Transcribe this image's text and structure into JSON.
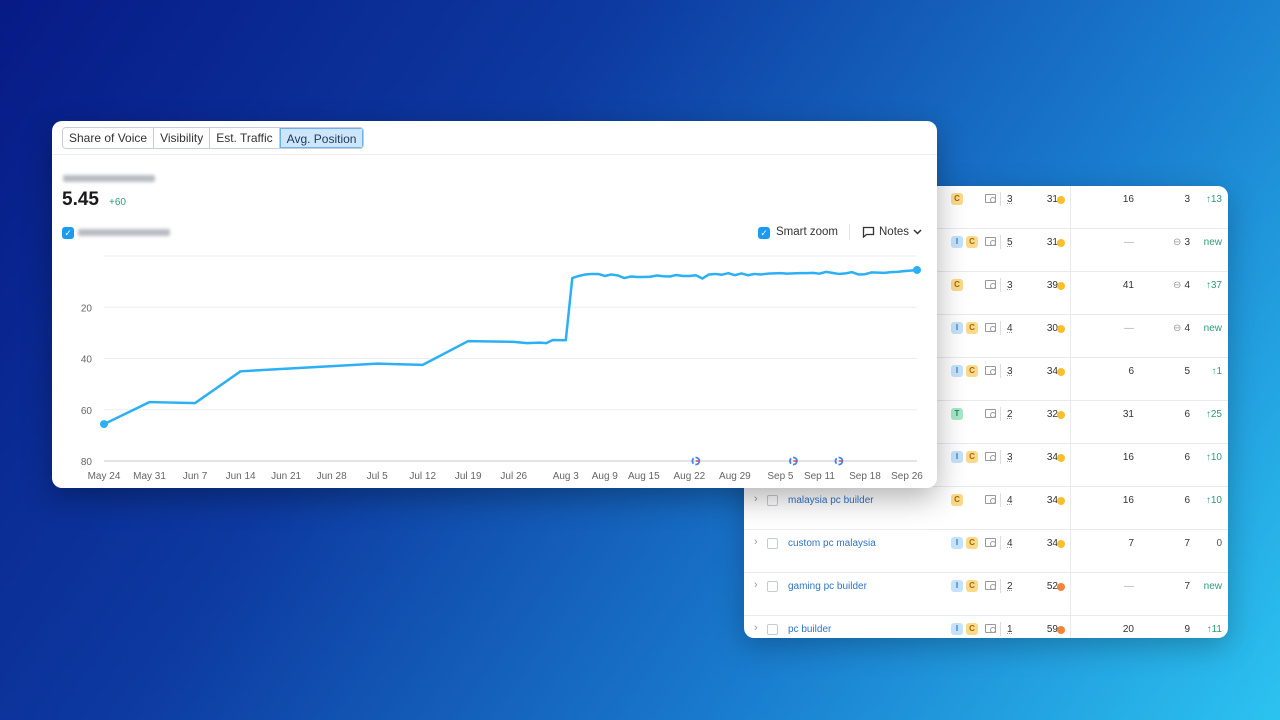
{
  "tabs": [
    {
      "label": "Share of Voice",
      "active": false
    },
    {
      "label": "Visibility",
      "active": false
    },
    {
      "label": "Est. Traffic",
      "active": false
    },
    {
      "label": "Avg. Position",
      "active": true
    }
  ],
  "metric": {
    "value": "5.45",
    "delta": "+60"
  },
  "controls": {
    "smart_zoom_label": "Smart zoom",
    "smart_zoom_checked": true,
    "notes_label": "Notes"
  },
  "colors": {
    "line": "#2bb0f5",
    "accent": "#1a9bf0",
    "positive": "#2a9d78",
    "kd_yellow": "#fbbf2d",
    "kd_orange": "#f5833a"
  },
  "chart_data": {
    "type": "line",
    "y_inverted": true,
    "ylim": [
      0,
      80
    ],
    "y_ticks": [
      "20",
      "40",
      "60",
      "80"
    ],
    "x_ticks": [
      "May 24",
      "May 31",
      "Jun 7",
      "Jun 14",
      "Jun 21",
      "Jun 28",
      "Jul 5",
      "Jul 12",
      "Jul 19",
      "Jul 26",
      "Aug 3",
      "Aug 9",
      "Aug 15",
      "Aug 22",
      "Aug 29",
      "Sep 5",
      "Sep 11",
      "Sep 18",
      "Sep 26"
    ],
    "grid": true,
    "google_update_markers": [
      "Aug 23",
      "Sep 7",
      "Sep 14"
    ],
    "points": [
      [
        "May 24",
        65.6
      ],
      [
        "May 31",
        57
      ],
      [
        "Jun 7",
        57.4
      ],
      [
        "Jun 14",
        45
      ],
      [
        "Jul 5",
        42
      ],
      [
        "Jul 12",
        42.5
      ],
      [
        "Jul 19",
        33.2
      ],
      [
        "Jul 26",
        33.5
      ],
      [
        "Jul 28",
        34
      ],
      [
        "Jul 30",
        33.8
      ],
      [
        "Jul 31",
        34
      ],
      [
        "Aug 1",
        32.8
      ],
      [
        "Aug 3",
        32.9
      ],
      [
        "Aug 4",
        8.6
      ],
      [
        "Aug 5",
        7.8
      ],
      [
        "Aug 6",
        7.2
      ],
      [
        "Aug 7",
        7.0
      ],
      [
        "Aug 8",
        7.0
      ],
      [
        "Aug 9",
        7.8
      ],
      [
        "Aug 10",
        7.2
      ],
      [
        "Aug 11",
        7.6
      ],
      [
        "Aug 12",
        8.6
      ],
      [
        "Aug 13",
        8.0
      ],
      [
        "Aug 14",
        8.2
      ],
      [
        "Aug 15",
        8.2
      ],
      [
        "Aug 16",
        8.1
      ],
      [
        "Aug 17",
        7.6
      ],
      [
        "Aug 18",
        7.9
      ],
      [
        "Aug 19",
        8.0
      ],
      [
        "Aug 20",
        7.4
      ],
      [
        "Aug 21",
        7.8
      ],
      [
        "Aug 22",
        7.8
      ],
      [
        "Aug 23",
        7.5
      ],
      [
        "Aug 24",
        8.8
      ],
      [
        "Aug 25",
        7.2
      ],
      [
        "Aug 26",
        7.0
      ],
      [
        "Aug 27",
        7.3
      ],
      [
        "Aug 28",
        6.7
      ],
      [
        "Aug 29",
        7.5
      ],
      [
        "Aug 30",
        6.8
      ],
      [
        "Aug 31",
        7.5
      ],
      [
        "Sep 1",
        7.0
      ],
      [
        "Sep 2",
        7.2
      ],
      [
        "Sep 3",
        6.9
      ],
      [
        "Sep 4",
        6.8
      ],
      [
        "Sep 5",
        6.7
      ],
      [
        "Sep 6",
        6.9
      ],
      [
        "Sep 7",
        6.8
      ],
      [
        "Sep 8",
        6.7
      ],
      [
        "Sep 9",
        6.7
      ],
      [
        "Sep 10",
        6.6
      ],
      [
        "Sep 11",
        6.9
      ],
      [
        "Sep 12",
        6.2
      ],
      [
        "Sep 13",
        6.6
      ],
      [
        "Sep 14",
        7.0
      ],
      [
        "Sep 15",
        6.8
      ],
      [
        "Sep 16",
        6.3
      ],
      [
        "Sep 17",
        7.2
      ],
      [
        "Sep 18",
        7.1
      ],
      [
        "Sep 19",
        6.4
      ],
      [
        "Sep 20",
        6.5
      ],
      [
        "Sep 21",
        6.6
      ],
      [
        "Sep 22",
        6.3
      ],
      [
        "Sep 23",
        6.2
      ],
      [
        "Sep 24",
        5.9
      ],
      [
        "Sep 25",
        5.7
      ],
      [
        "Sep 26",
        5.45
      ]
    ]
  },
  "keywords": [
    {
      "keyword": "",
      "intents": [
        "C"
      ],
      "results": "3",
      "kd": "31",
      "kd_level": "yellow",
      "volume": "16",
      "links": "3",
      "link_icon": false,
      "change": "13",
      "change_type": "up"
    },
    {
      "keyword": "",
      "intents": [
        "I",
        "C"
      ],
      "results": "5",
      "kd": "31",
      "kd_level": "yellow",
      "volume": "—",
      "links": "3",
      "link_icon": true,
      "change": "new",
      "change_type": "new"
    },
    {
      "keyword": "",
      "intents": [
        "C"
      ],
      "results": "3",
      "kd": "39",
      "kd_level": "yellow",
      "volume": "41",
      "links": "4",
      "link_icon": true,
      "change": "37",
      "change_type": "up"
    },
    {
      "keyword": "",
      "intents": [
        "I",
        "C"
      ],
      "results": "4",
      "kd": "30",
      "kd_level": "yellow",
      "volume": "—",
      "links": "4",
      "link_icon": true,
      "change": "new",
      "change_type": "new"
    },
    {
      "keyword": "",
      "intents": [
        "I",
        "C"
      ],
      "results": "3",
      "kd": "34",
      "kd_level": "yellow",
      "volume": "6",
      "links": "5",
      "link_icon": false,
      "change": "1",
      "change_type": "up"
    },
    {
      "keyword": "",
      "intents": [
        "T"
      ],
      "results": "2",
      "kd": "32",
      "kd_level": "yellow",
      "volume": "31",
      "links": "6",
      "link_icon": false,
      "change": "25",
      "change_type": "up"
    },
    {
      "keyword": "",
      "intents": [
        "I",
        "C"
      ],
      "results": "3",
      "kd": "34",
      "kd_level": "yellow",
      "volume": "16",
      "links": "6",
      "link_icon": false,
      "change": "10",
      "change_type": "up"
    },
    {
      "keyword": "malaysia pc builder",
      "intents": [
        "C"
      ],
      "results": "4",
      "kd": "34",
      "kd_level": "yellow",
      "volume": "16",
      "links": "6",
      "link_icon": false,
      "change": "10",
      "change_type": "up"
    },
    {
      "keyword": "custom pc malaysia",
      "intents": [
        "I",
        "C"
      ],
      "results": "4",
      "kd": "34",
      "kd_level": "yellow",
      "volume": "7",
      "links": "7",
      "link_icon": false,
      "change": "0",
      "change_type": "none"
    },
    {
      "keyword": "gaming pc builder",
      "intents": [
        "I",
        "C"
      ],
      "results": "2",
      "kd": "52",
      "kd_level": "orange",
      "volume": "—",
      "links": "7",
      "link_icon": false,
      "change": "new",
      "change_type": "new"
    },
    {
      "keyword": "pc builder",
      "intents": [
        "I",
        "C"
      ],
      "results": "1",
      "kd": "59",
      "kd_level": "orange",
      "volume": "20",
      "links": "9",
      "link_icon": false,
      "change": "11",
      "change_type": "up"
    }
  ]
}
